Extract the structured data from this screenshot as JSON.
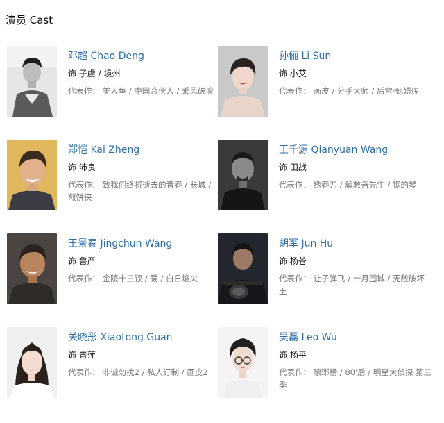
{
  "section": {
    "title": "演员 Cast"
  },
  "cast": [
    {
      "name": "邓超 Chao Deng",
      "role": "饰 子虞 / 境州",
      "works": "代表作：  美人鱼 / 中国合伙人 / 乘风破浪"
    },
    {
      "name": "孙俪 Li Sun",
      "role": "饰 小艾",
      "works": "代表作：  画皮 / 分手大师 / 后宫·甄嬛传"
    },
    {
      "name": "郑恺 Kai Zheng",
      "role": "饰 沛良",
      "works": "代表作：  致我们终将逝去的青春 / 长城 / 煎饼侠"
    },
    {
      "name": "王千源 Qianyuan Wang",
      "role": "饰 田战",
      "works": "代表作：  绣春刀 / 解救吾先生 / 钢的琴"
    },
    {
      "name": "王景春 Jingchun Wang",
      "role": "饰 鲁严",
      "works": "代表作：  金陵十三钗 / 爱 / 白日焰火"
    },
    {
      "name": "胡军 Jun Hu",
      "role": "饰 杨苍",
      "works": "代表作：  让子弹飞 / 十月围城 / 无敌破坏王"
    },
    {
      "name": "关晓彤 Xiaotong Guan",
      "role": "饰 青萍",
      "works": "代表作：  非诚勿扰2 / 私人订制 / 画皮2"
    },
    {
      "name": "吴磊 Leo Wu",
      "role": "饰 杨平",
      "works": "代表作：  琅琊榜 / 80'后 / 明星大侦探 第三季"
    }
  ]
}
